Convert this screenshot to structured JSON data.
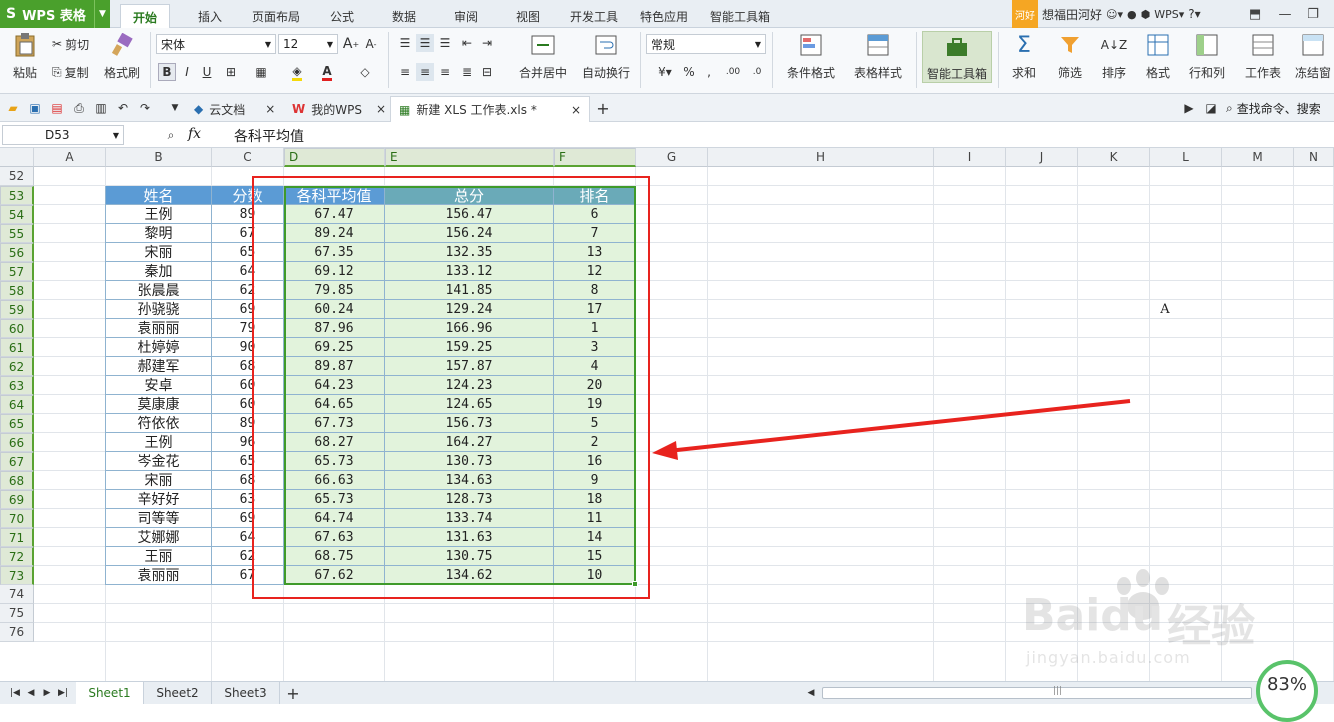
{
  "app": {
    "name": "WPS 表格"
  },
  "ribbon_tabs": [
    "开始",
    "插入",
    "页面布局",
    "公式",
    "数据",
    "审阅",
    "视图",
    "开发工具",
    "特色应用",
    "智能工具箱"
  ],
  "user": {
    "badge": "河好",
    "name": "想福田河好"
  },
  "ribbon": {
    "paste": "粘贴",
    "cut": "剪切",
    "copy": "复制",
    "format_painter": "格式刷",
    "font_name": "宋体",
    "font_size": "12",
    "bold": "B",
    "italic": "I",
    "underline": "U",
    "merge_center": "合并居中",
    "wrap_text": "自动换行",
    "number_format": "常规",
    "percent": "%",
    "conditional_format": "条件格式",
    "table_style": "表格样式",
    "smart_toolbox": "智能工具箱",
    "sum": "求和",
    "filter": "筛选",
    "sort": "排序",
    "format": "格式",
    "row_col": "行和列",
    "worksheet": "工作表",
    "freeze": "冻结窗"
  },
  "doc_tabs": [
    {
      "label": "云文档"
    },
    {
      "label": "我的WPS"
    },
    {
      "label": "新建 XLS 工作表.xls *"
    }
  ],
  "search_command": "查找命令、搜索",
  "formula_bar": {
    "name_box": "D53",
    "fx": "fx",
    "content": "各科平均值"
  },
  "columns": [
    "A",
    "B",
    "C",
    "D",
    "E",
    "F",
    "G",
    "H",
    "I",
    "J",
    "K",
    "L",
    "M",
    "N"
  ],
  "rows": [
    "52",
    "53",
    "54",
    "55",
    "56",
    "57",
    "58",
    "59",
    "60",
    "61",
    "62",
    "63",
    "64",
    "65",
    "66",
    "67",
    "68",
    "69",
    "70",
    "71",
    "72",
    "73",
    "74",
    "75",
    "76"
  ],
  "table": {
    "headers": [
      "姓名",
      "分数",
      "各科平均值",
      "总分",
      "排名"
    ],
    "rows": [
      [
        "王例",
        "89",
        "67.47",
        "156.47",
        "6"
      ],
      [
        "黎明",
        "67",
        "89.24",
        "156.24",
        "7"
      ],
      [
        "宋丽",
        "65",
        "67.35",
        "132.35",
        "13"
      ],
      [
        "秦加",
        "64",
        "69.12",
        "133.12",
        "12"
      ],
      [
        "张晨晨",
        "62",
        "79.85",
        "141.85",
        "8"
      ],
      [
        "孙骁骁",
        "69",
        "60.24",
        "129.24",
        "17"
      ],
      [
        "袁丽丽",
        "79",
        "87.96",
        "166.96",
        "1"
      ],
      [
        "杜婷婷",
        "90",
        "69.25",
        "159.25",
        "3"
      ],
      [
        "郝建军",
        "68",
        "89.87",
        "157.87",
        "4"
      ],
      [
        "安卓",
        "60",
        "64.23",
        "124.23",
        "20"
      ],
      [
        "莫康康",
        "60",
        "64.65",
        "124.65",
        "19"
      ],
      [
        "符依依",
        "89",
        "67.73",
        "156.73",
        "5"
      ],
      [
        "王例",
        "96",
        "68.27",
        "164.27",
        "2"
      ],
      [
        "岑金花",
        "65",
        "65.73",
        "130.73",
        "16"
      ],
      [
        "宋丽",
        "68",
        "66.63",
        "134.63",
        "9"
      ],
      [
        "辛好好",
        "63",
        "65.73",
        "128.73",
        "18"
      ],
      [
        "司等等",
        "69",
        "64.74",
        "133.74",
        "11"
      ],
      [
        "艾娜娜",
        "64",
        "67.63",
        "131.63",
        "14"
      ],
      [
        "王丽",
        "62",
        "68.75",
        "130.75",
        "15"
      ],
      [
        "袁丽丽",
        "67",
        "67.62",
        "134.62",
        "10"
      ]
    ]
  },
  "stray_cell": {
    "text": "A"
  },
  "sheets": [
    "Sheet1",
    "Sheet2",
    "Sheet3"
  ],
  "zoom": "83%",
  "watermark": {
    "brand": "Baidu",
    "suffix": "经验",
    "url": "jingyan.baidu.com"
  },
  "colors": {
    "accent": "#4aa02c",
    "header_blue": "#5b9bd5",
    "header_teal": "#6aaab8",
    "selection_fill": "#e2f3dc",
    "annotation_red": "#e8231e"
  }
}
